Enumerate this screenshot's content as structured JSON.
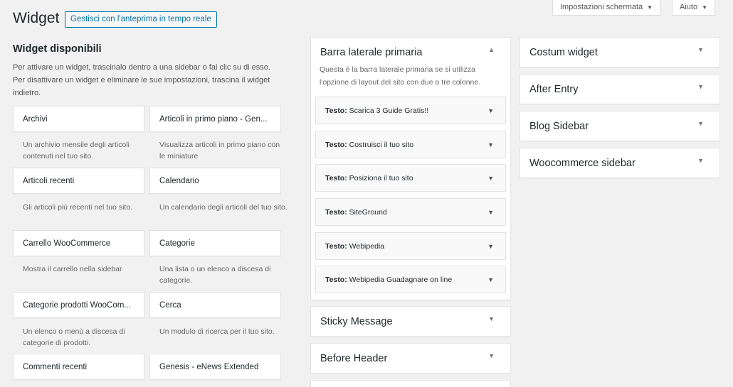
{
  "header": {
    "title": "Widget",
    "live_preview_button": "Gestisci con l'anteprima in tempo reale",
    "screen_options": "Impostazioni schermata",
    "help": "Aiuto",
    "dropdown_arrow": "▼"
  },
  "available": {
    "title": "Widget disponibili",
    "description": "Per attivare un widget, trascinalo dentro a una sidebar o fai clic su di esso. Per disattivare un widget e eliminare le sue impostazioni, trascina il widget indietro.",
    "widgets": [
      {
        "name": "Archivi",
        "desc": "Un archivio mensile degli articoli contenuti nel tuo sito."
      },
      {
        "name": "Articoli in primo piano - Gen...",
        "desc": "Visualizza articoli in primo piano con le miniature"
      },
      {
        "name": "Articoli recenti",
        "desc": "Gli articoli più recenti nel tuo sito."
      },
      {
        "name": "Calendario",
        "desc": "Un calendario degli articoli del tuo sito."
      },
      {
        "name": "Carrello WooCommerce",
        "desc": "Mostra il carrello nella sidebar"
      },
      {
        "name": "Categorie",
        "desc": "Una lista o un elenco a discesa di categorie."
      },
      {
        "name": "Categorie prodotti WooCom...",
        "desc": "Un elenco o menù a discesa di categorie di prodotti."
      },
      {
        "name": "Cerca",
        "desc": "Un modulo di ricerca per il tuo sito."
      },
      {
        "name": "Commenti recenti",
        "desc": ""
      },
      {
        "name": "Genesis - eNews Extended",
        "desc": ""
      }
    ]
  },
  "primary_sidebar": {
    "title": "Barra laterale primaria",
    "arrow": "▲",
    "description": "Questa è la barra laterale primaria se si utilizza l'opzione di layout del sito con due o tre colonne.",
    "widget_prefix": "Testo:",
    "widgets": [
      {
        "title": "Scarica 3 Guide Gratis!!"
      },
      {
        "title": "Costruisci il tuo sito"
      },
      {
        "title": "Posiziona il tuo sito"
      },
      {
        "title": "SiteGround"
      },
      {
        "title": "Webipedia"
      },
      {
        "title": "Webipedia Guadagnare on line"
      }
    ]
  },
  "middle_sidebars": [
    {
      "title": "Sticky Message"
    },
    {
      "title": "Before Header"
    }
  ],
  "right_sidebars": [
    {
      "title": "Costum widget"
    },
    {
      "title": "After Entry"
    },
    {
      "title": "Blog Sidebar"
    },
    {
      "title": "Woocommerce sidebar"
    }
  ]
}
